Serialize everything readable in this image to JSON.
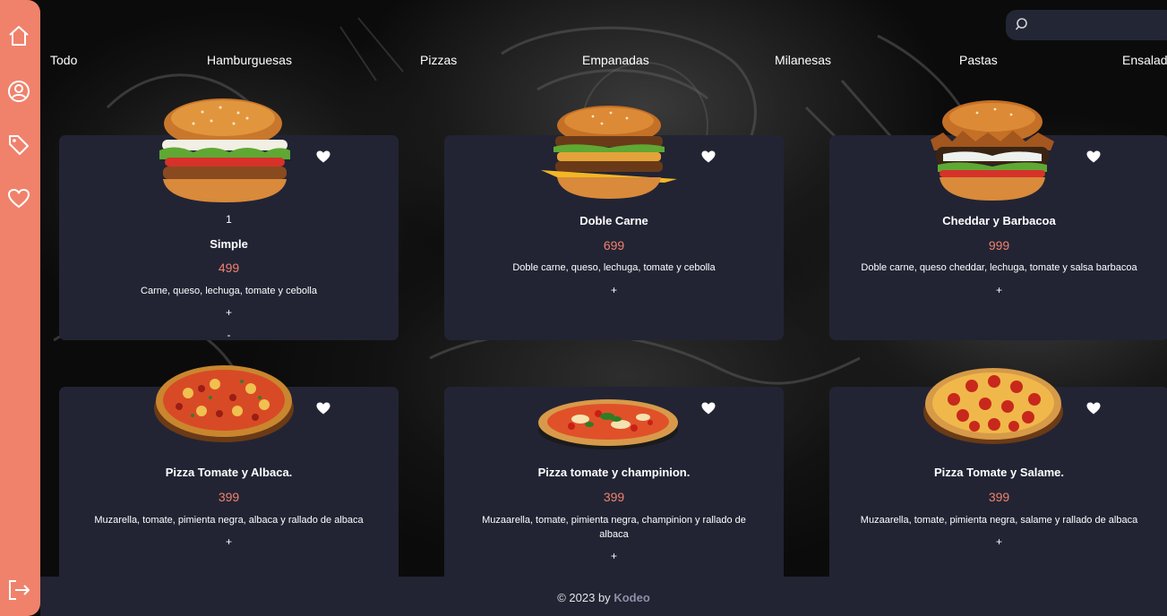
{
  "search": {
    "placeholder": "",
    "value": ""
  },
  "sidebar": {
    "icons": [
      "home-icon",
      "user-icon",
      "tag-icon",
      "heart-icon",
      "logout-icon"
    ]
  },
  "categories": [
    "Todo",
    "Hamburguesas",
    "Pizzas",
    "Empanadas",
    "Milanesas",
    "Pastas",
    "Ensaladas"
  ],
  "products": [
    {
      "quantity": "1",
      "name": "Simple",
      "price": "499",
      "description": "Carne, queso, lechuga, tomate y cebolla",
      "add": "+",
      "remove": "-"
    },
    {
      "name": "Doble Carne",
      "price": "699",
      "description": "Doble carne, queso, lechuga, tomate y cebolla",
      "add": "+"
    },
    {
      "name": "Cheddar y Barbacoa",
      "price": "999",
      "description": "Doble carne, queso cheddar, lechuga, tomate y salsa barbacoa",
      "add": "+"
    },
    {
      "name": "Pizza Tomate y Albaca.",
      "price": "399",
      "description": "Muzarella, tomate, pimienta negra, albaca y rallado de albaca",
      "add": "+"
    },
    {
      "name": "Pizza tomate y champinion.",
      "price": "399",
      "description": "Muzaarella, tomate, pimienta negra, champinion y rallado de albaca",
      "add": "+"
    },
    {
      "name": "Pizza Tomate y Salame.",
      "price": "399",
      "description": "Muzaarella, tomate, pimienta negra, salame y rallado de albaca",
      "add": "+"
    }
  ],
  "footer": {
    "text": "© 2023 by",
    "brand": "Kodeo"
  },
  "colors": {
    "accent": "#f0826c",
    "card": "#222434",
    "background": "#000000"
  }
}
